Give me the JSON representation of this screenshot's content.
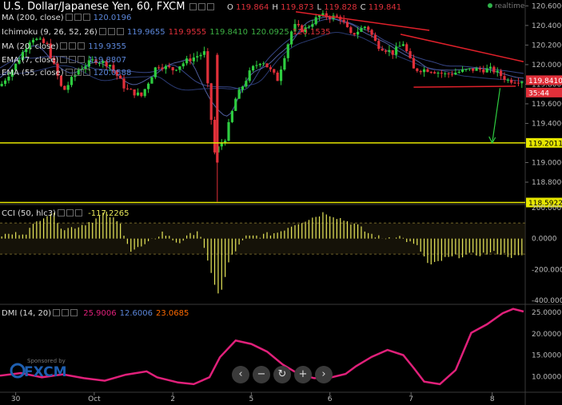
{
  "header": {
    "title": "U.S. Dollar/Japanese Yen, 60, FXCM",
    "ohlc": [
      {
        "k": "O",
        "v": "119.864"
      },
      {
        "k": "H",
        "v": "119.873"
      },
      {
        "k": "L",
        "v": "119.828"
      },
      {
        "k": "C",
        "v": "119.841"
      }
    ],
    "realtime": "realtime"
  },
  "indicators": [
    {
      "label": "MA (200, close)",
      "values": [
        {
          "v": "120.0196",
          "color": "#5b86d9"
        }
      ]
    },
    {
      "label": "Ichimoku (9, 26, 52, 26)",
      "values": [
        {
          "v": "119.9655",
          "color": "#5b86d9"
        },
        {
          "v": "119.9555",
          "color": "#e0303a"
        },
        {
          "v": "119.8410",
          "color": "#3cb043"
        },
        {
          "v": "120.0925",
          "color": "#3cb043"
        },
        {
          "v": "120.1535",
          "color": "#e0303a"
        }
      ]
    },
    {
      "label": "MA (20, close)",
      "values": [
        {
          "v": "119.9355",
          "color": "#5b86d9"
        }
      ]
    },
    {
      "label": "EMA (7, close)",
      "values": [
        {
          "v": "119.8807",
          "color": "#5b86d9"
        }
      ]
    },
    {
      "label": "EMA (55, close)",
      "values": [
        {
          "v": "120.0588",
          "color": "#5b86d9"
        }
      ]
    }
  ],
  "cci": {
    "label": "CCI (50, hlc3)",
    "value": "-117.2265",
    "value_color": "#e8e85a"
  },
  "dmi": {
    "label": "DMI (14, 20)",
    "values": [
      {
        "v": "25.9006",
        "color": "#e0207a"
      },
      {
        "v": "12.6006",
        "color": "#5b86d9"
      },
      {
        "v": "23.0685",
        "color": "#ff6a00"
      }
    ]
  },
  "sponsor": {
    "line1": "Sponsored by",
    "brand": "FXCM"
  },
  "nav_icons": [
    "rewind-icon",
    "zoom-out-icon",
    "reset-icon",
    "zoom-in-icon",
    "forward-icon"
  ],
  "colors": {
    "bull": "#2ecc40",
    "bear": "#e0303a",
    "trend": "#e0202a",
    "hline": "#e6e600",
    "cci": "#e8e85a",
    "dmi": "#e0207a",
    "arrow": "#2ecc40"
  },
  "chart_data": [
    {
      "type": "candlestick",
      "y_ticks": [
        120.6,
        120.4,
        120.2,
        120.0,
        119.8,
        119.6,
        119.4,
        119.2,
        119.0,
        118.8
      ],
      "ylim": [
        118.58,
        120.66
      ],
      "x_ticks": [
        "30",
        "Oct",
        "2",
        "5",
        "6",
        "7",
        "8"
      ],
      "price_labels": [
        {
          "v": 119.841,
          "text": "119.8410",
          "bg": "#e0303a",
          "fg": "#ffffff"
        },
        {
          "v": 119.78,
          "text": "35:44",
          "bg": "#e0303a",
          "fg": "#ffffff"
        },
        {
          "v": 119.2011,
          "text": "119.2011",
          "bg": "#e6e600",
          "fg": "#000000"
        },
        {
          "v": 118.5922,
          "text": "118.5922",
          "bg": "#e6e600",
          "fg": "#000000"
        }
      ],
      "hlines": [
        119.2011,
        118.5922
      ],
      "trendlines": [
        {
          "x0": 0.565,
          "y0": 120.54,
          "x1": 0.82,
          "y1": 120.35
        },
        {
          "x0": 0.765,
          "y0": 120.31,
          "x1": 1.0,
          "y1": 120.03
        },
        {
          "x0": 0.79,
          "y0": 119.77,
          "x1": 0.985,
          "y1": 119.78
        }
      ],
      "arrow": {
        "x0": 0.955,
        "y0": 119.76,
        "x1": 0.94,
        "y1": 119.2
      },
      "candle_anchors": [
        [
          0,
          119.78
        ],
        [
          0.03,
          120.0
        ],
        [
          0.06,
          120.28
        ],
        [
          0.09,
          120.2
        ],
        [
          0.12,
          119.72
        ],
        [
          0.15,
          119.95
        ],
        [
          0.18,
          120.05
        ],
        [
          0.21,
          120.0
        ],
        [
          0.24,
          119.75
        ],
        [
          0.27,
          119.68
        ],
        [
          0.3,
          120.0
        ],
        [
          0.33,
          119.95
        ],
        [
          0.36,
          120.05
        ],
        [
          0.39,
          120.12
        ],
        [
          0.41,
          119.1
        ],
        [
          0.43,
          119.25
        ],
        [
          0.45,
          119.65
        ],
        [
          0.48,
          119.95
        ],
        [
          0.5,
          120.05
        ],
        [
          0.53,
          119.85
        ],
        [
          0.56,
          120.4
        ],
        [
          0.58,
          120.35
        ],
        [
          0.61,
          120.5
        ],
        [
          0.65,
          120.48
        ],
        [
          0.67,
          120.3
        ],
        [
          0.7,
          120.4
        ],
        [
          0.72,
          120.2
        ],
        [
          0.75,
          120.12
        ],
        [
          0.77,
          120.22
        ],
        [
          0.79,
          119.95
        ],
        [
          0.82,
          119.95
        ],
        [
          0.85,
          119.9
        ],
        [
          0.9,
          119.95
        ],
        [
          0.94,
          119.95
        ],
        [
          0.97,
          119.84
        ]
      ]
    },
    {
      "type": "bar",
      "name": "CCI (50, hlc3)",
      "y_ticks": [
        200.0,
        0.0,
        -200.0,
        -400.0
      ],
      "ylim": [
        -420,
        210
      ],
      "levels": [
        100,
        -100
      ],
      "bar_anchors": [
        [
          0,
          20
        ],
        [
          0.05,
          40
        ],
        [
          0.08,
          140
        ],
        [
          0.1,
          170
        ],
        [
          0.12,
          60
        ],
        [
          0.15,
          80
        ],
        [
          0.18,
          120
        ],
        [
          0.2,
          170
        ],
        [
          0.23,
          90
        ],
        [
          0.25,
          -80
        ],
        [
          0.28,
          -40
        ],
        [
          0.31,
          40
        ],
        [
          0.34,
          -30
        ],
        [
          0.38,
          60
        ],
        [
          0.4,
          -200
        ],
        [
          0.42,
          -380
        ],
        [
          0.44,
          -120
        ],
        [
          0.47,
          10
        ],
        [
          0.5,
          20
        ],
        [
          0.53,
          40
        ],
        [
          0.56,
          90
        ],
        [
          0.6,
          140
        ],
        [
          0.62,
          170
        ],
        [
          0.65,
          130
        ],
        [
          0.68,
          90
        ],
        [
          0.7,
          40
        ],
        [
          0.73,
          0
        ],
        [
          0.76,
          20
        ],
        [
          0.8,
          -60
        ],
        [
          0.82,
          -180
        ],
        [
          0.85,
          -130
        ],
        [
          0.88,
          -110
        ],
        [
          0.92,
          -100
        ],
        [
          0.95,
          -90
        ],
        [
          0.98,
          -117
        ]
      ]
    },
    {
      "type": "line",
      "name": "DMI (14, 20)",
      "y_ticks": [
        25.0,
        20.0,
        15.0,
        10.0
      ],
      "ylim": [
        6.5,
        26.5
      ],
      "x": [
        0,
        0.04,
        0.08,
        0.12,
        0.16,
        0.2,
        0.24,
        0.28,
        0.3,
        0.34,
        0.37,
        0.4,
        0.42,
        0.45,
        0.48,
        0.51,
        0.54,
        0.57,
        0.6,
        0.63,
        0.66,
        0.68,
        0.71,
        0.74,
        0.77,
        0.79,
        0.81,
        0.84,
        0.87,
        0.9,
        0.93,
        0.96,
        0.98,
        1.0
      ],
      "values": [
        10.2,
        10.8,
        9.8,
        10.5,
        9.6,
        9.0,
        10.4,
        11.2,
        9.8,
        8.6,
        8.2,
        9.8,
        14.5,
        18.4,
        17.6,
        15.8,
        12.8,
        10.6,
        9.6,
        9.7,
        10.6,
        12.4,
        14.6,
        16.2,
        15.0,
        12.0,
        8.8,
        8.2,
        11.5,
        20.2,
        22.2,
        24.8,
        25.8,
        25.2
      ]
    }
  ]
}
